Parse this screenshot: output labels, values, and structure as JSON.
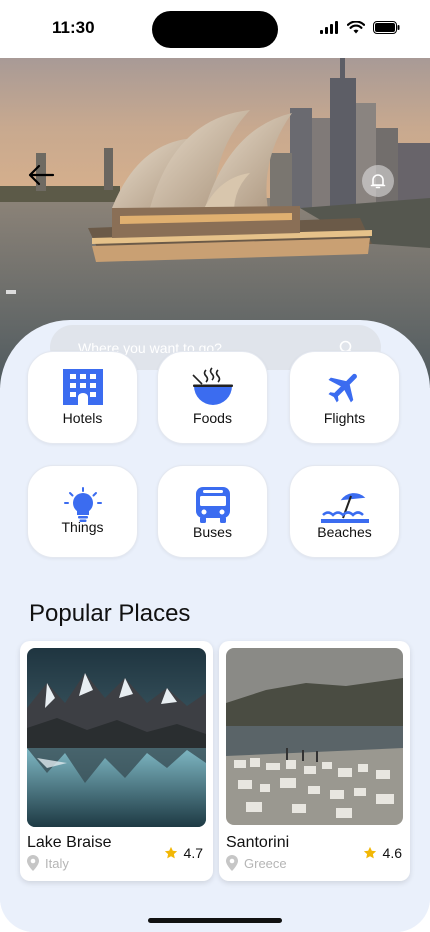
{
  "status_bar": {
    "time": "11:30"
  },
  "search": {
    "placeholder": "Where you want to go?"
  },
  "categories": [
    {
      "label": "Hotels",
      "icon": "hotel-icon"
    },
    {
      "label": "Foods",
      "icon": "food-bowl-icon"
    },
    {
      "label": "Flights",
      "icon": "airplane-icon"
    },
    {
      "label": "Things",
      "icon": "lightbulb-icon"
    },
    {
      "label": "Buses",
      "icon": "bus-icon"
    },
    {
      "label": "Beaches",
      "icon": "beach-umbrella-icon"
    }
  ],
  "popular": {
    "title": "Popular Places",
    "places": [
      {
        "name": "Lake Braise",
        "location": "Italy",
        "rating": "4.7"
      },
      {
        "name": "Santorini",
        "location": "Greece",
        "rating": "4.6"
      }
    ]
  },
  "colors": {
    "accent": "#3b6cf0",
    "panel": "#eaf0fb",
    "star": "#f2b705"
  }
}
